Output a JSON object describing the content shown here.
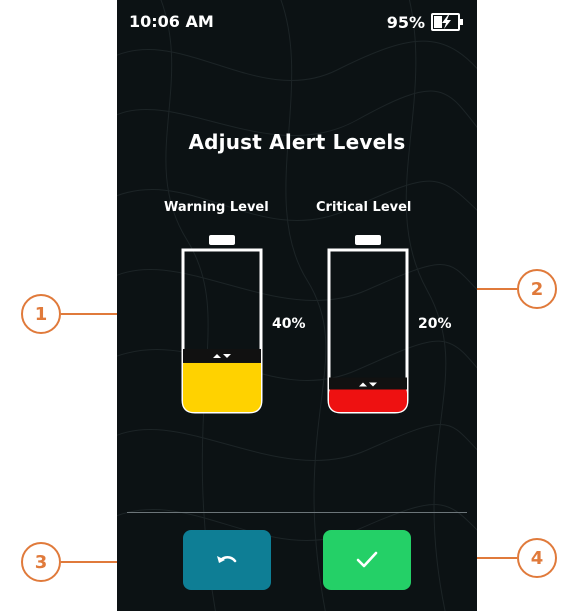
{
  "status_bar": {
    "time": "10:06 AM",
    "battery_percent": "95%",
    "battery_icon": "battery-charging-icon"
  },
  "screen": {
    "title": "Adjust Alert Levels"
  },
  "warning_level": {
    "label": "Warning Level",
    "value_text": "40%",
    "level": 0.4,
    "color": "#ffd200"
  },
  "critical_level": {
    "label": "Critical Level",
    "value_text": "20%",
    "level": 0.2,
    "color": "#ee1111"
  },
  "buttons": {
    "undo_icon": "undo-icon",
    "confirm_icon": "checkmark-icon",
    "undo_color": "#0e7e95",
    "confirm_color": "#24d067"
  },
  "callouts": {
    "one": "1",
    "two": "2",
    "three": "3",
    "four": "4",
    "color": "#e07a3b"
  }
}
